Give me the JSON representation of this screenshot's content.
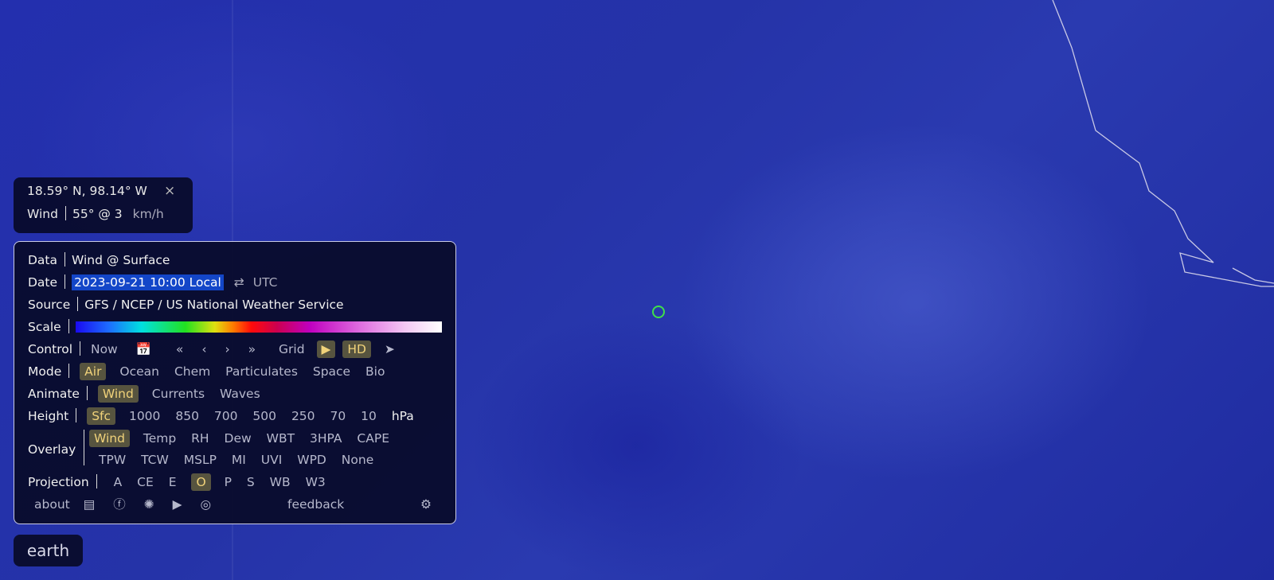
{
  "location": {
    "coords": "18.59° N, 98.14° W",
    "close_icon": "×",
    "wind_label": "Wind",
    "wind_value": "55° @ 3",
    "wind_unit": "km/h"
  },
  "menu": {
    "data": {
      "label": "Data",
      "value": "Wind @ Surface"
    },
    "date": {
      "label": "Date",
      "value": "2023-09-21 10:00 Local",
      "swap_icon": "⇄",
      "alt": "UTC"
    },
    "source": {
      "label": "Source",
      "value": "GFS / NCEP / US National Weather Service"
    },
    "scale": {
      "label": "Scale"
    },
    "control": {
      "label": "Control",
      "now": "Now",
      "calendar_icon": "📅",
      "back_fast": "«",
      "back": "‹",
      "forward": "›",
      "forward_fast": "»",
      "grid": "Grid",
      "play_icon": "▶",
      "hd": "HD",
      "locate_icon": "➤"
    },
    "mode": {
      "label": "Mode",
      "options": [
        "Air",
        "Ocean",
        "Chem",
        "Particulates",
        "Space",
        "Bio"
      ],
      "selected": "Air"
    },
    "animate": {
      "label": "Animate",
      "options": [
        "Wind",
        "Currents",
        "Waves"
      ],
      "selected": "Wind"
    },
    "height": {
      "label": "Height",
      "options": [
        "Sfc",
        "1000",
        "850",
        "700",
        "500",
        "250",
        "70",
        "10"
      ],
      "unit": "hPa",
      "selected": "Sfc"
    },
    "overlay": {
      "label": "Overlay",
      "row1": [
        "Wind",
        "Temp",
        "RH",
        "Dew",
        "WBT",
        "3HPA",
        "CAPE"
      ],
      "row2": [
        "TPW",
        "TCW",
        "MSLP",
        "MI",
        "UVI",
        "WPD",
        "None"
      ],
      "selected": "Wind"
    },
    "projection": {
      "label": "Projection",
      "options": [
        "A",
        "CE",
        "E",
        "O",
        "P",
        "S",
        "WB",
        "W3"
      ],
      "selected": "O"
    },
    "footer": {
      "about": "about",
      "feedback": "feedback"
    }
  },
  "earth_label": "earth",
  "colors": {
    "selected_bg": "#57543f",
    "selected_text": "#f0d27a",
    "marker": "#3fe04a",
    "ocean": "#2330a8"
  }
}
